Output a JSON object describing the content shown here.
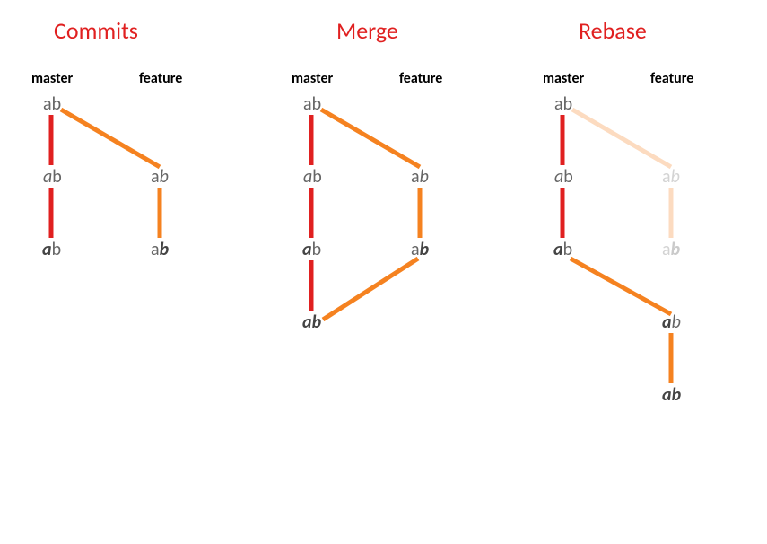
{
  "titles": {
    "commits": "Commits",
    "merge": "Merge",
    "rebase": "Rebase"
  },
  "labels": {
    "master": "master",
    "feature": "feature"
  },
  "glyphs": {
    "a": "a",
    "b": "b"
  },
  "colors": {
    "title": "#e02020",
    "red": "#e02020",
    "orange": "#f58220",
    "nodeText": "#666666"
  },
  "diagram": {
    "description": "Three side-by-side git commit graphs showing Commits, Merge, and Rebase strategies for master vs feature branches",
    "panels": [
      {
        "name": "commits",
        "branches": [
          "master",
          "feature"
        ],
        "master_commits": [
          "ab",
          "a(italic)b",
          "a(bold)b"
        ],
        "feature_commits": [
          "ab(italic)",
          "ab(bold)"
        ]
      },
      {
        "name": "merge",
        "branches": [
          "master",
          "feature"
        ],
        "master_commits": [
          "ab",
          "a(italic)b",
          "a(bold)b",
          "a(bold)b(bold) (merge)"
        ],
        "feature_commits": [
          "ab(italic)",
          "ab(bold)"
        ]
      },
      {
        "name": "rebase",
        "branches": [
          "master",
          "feature"
        ],
        "master_commits": [
          "ab",
          "a(italic)b",
          "a(bold)b"
        ],
        "feature_commits_old_faded": [
          "ab(italic)",
          "ab(bold)"
        ],
        "feature_commits_rebased": [
          "a(bold)b(italic)",
          "a(bold)b(bold)"
        ]
      }
    ]
  }
}
